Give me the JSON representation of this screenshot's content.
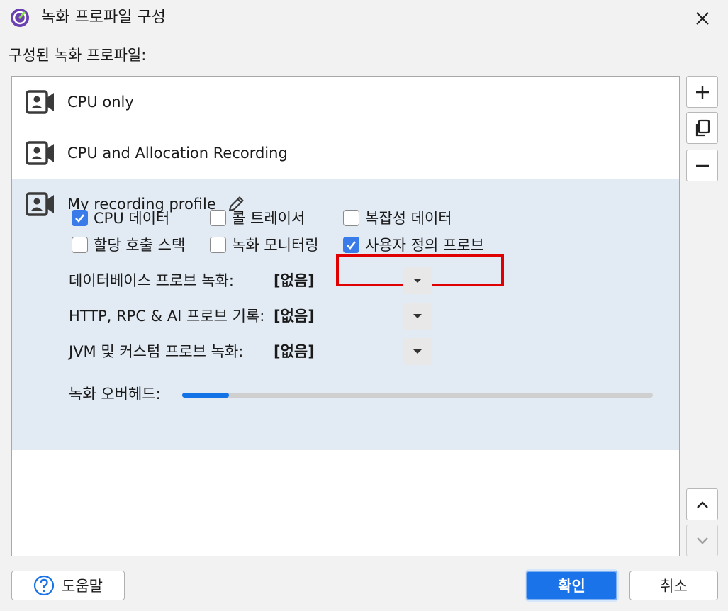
{
  "window": {
    "title": "녹화 프로파일 구성"
  },
  "section_label": "구성된 녹화 프로파일:",
  "profiles": [
    {
      "name": "CPU only"
    },
    {
      "name": "CPU and Allocation Recording"
    },
    {
      "name": "My recording profile"
    }
  ],
  "options": [
    {
      "label": "CPU 데이터",
      "checked": true
    },
    {
      "label": "콜 트레이서",
      "checked": false
    },
    {
      "label": "복잡성 데이터",
      "checked": false
    },
    {
      "label": "할당 호출 스택",
      "checked": false
    },
    {
      "label": "녹화 모니터링",
      "checked": false
    },
    {
      "label": "사용자 정의 프로브",
      "checked": true
    }
  ],
  "fields": [
    {
      "label": "데이터베이스 프로브 녹화:",
      "value": "[없음]"
    },
    {
      "label": "HTTP, RPC & AI 프로브 기록:",
      "value": "[없음]"
    },
    {
      "label": "JVM 및 커스텀 프로브 녹화:",
      "value": "[없음]"
    }
  ],
  "overhead": {
    "label": "녹화 오버헤드:",
    "level": 0.1
  },
  "buttons": {
    "help": "도움말",
    "ok": "확인",
    "cancel": "취소"
  },
  "colors": {
    "accent": "#1a73e8",
    "highlight": "#e00000",
    "selected_row": "#e2ebf4"
  }
}
